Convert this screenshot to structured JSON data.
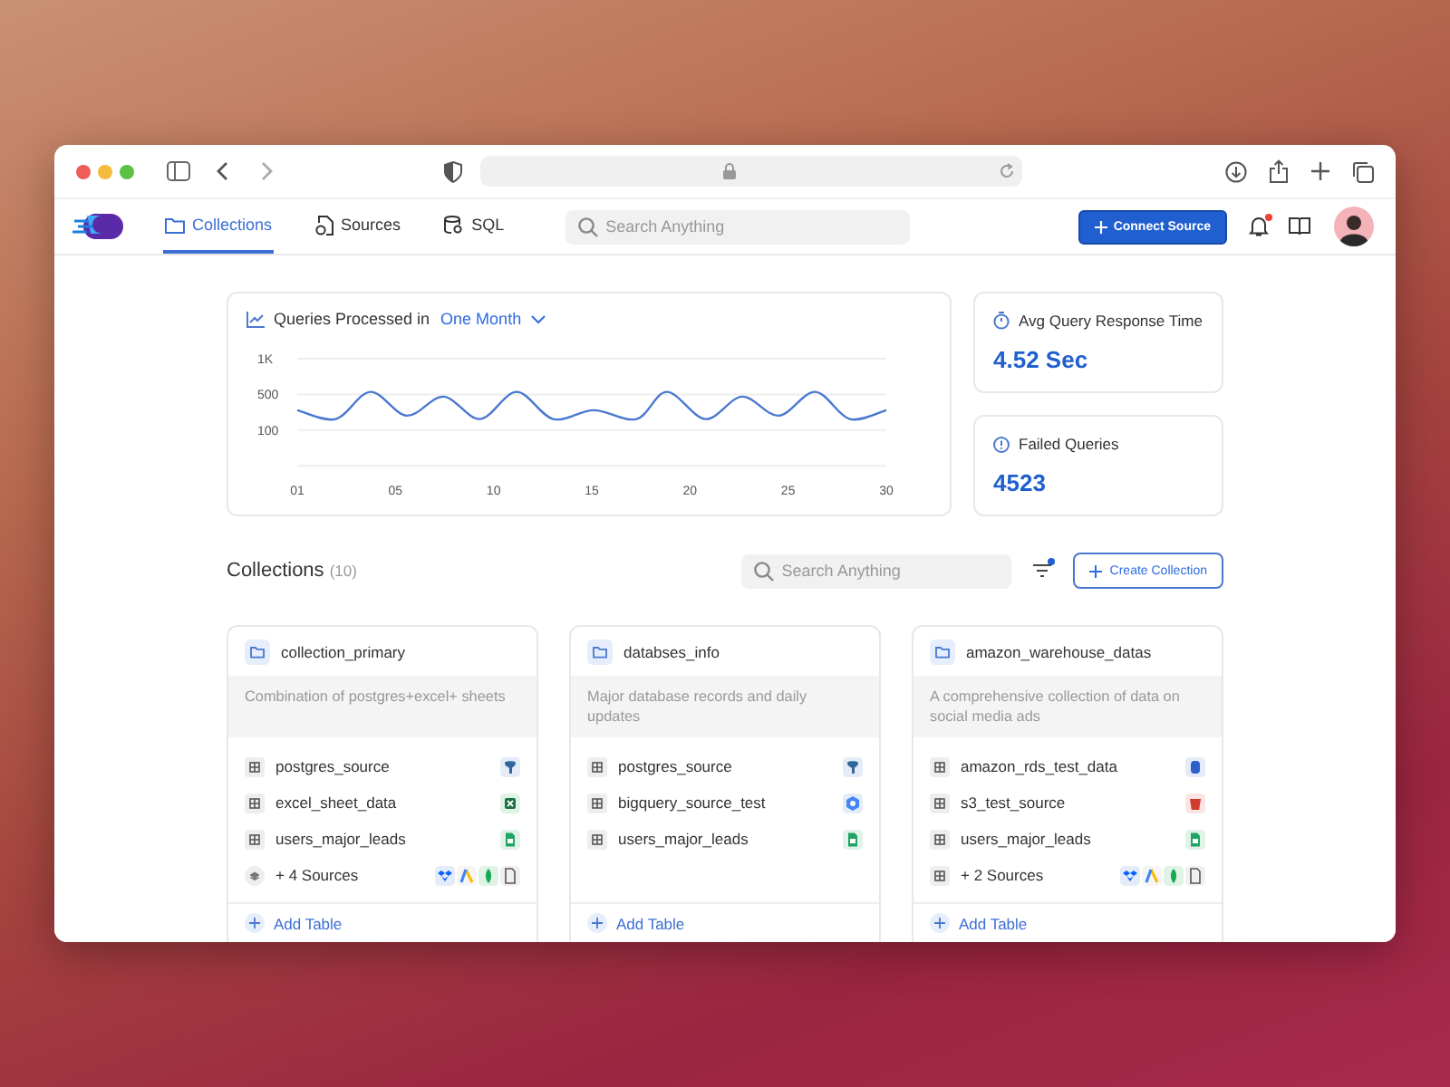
{
  "nav": {
    "tabs": [
      {
        "label": "Collections",
        "kind": "folder",
        "selected": true
      },
      {
        "label": "Sources",
        "kind": "sources",
        "selected": false
      },
      {
        "label": "SQL",
        "kind": "sql",
        "selected": false
      }
    ],
    "search": {
      "placeholder": "Search Anything"
    },
    "connect_button": "Connect Source",
    "notifications": {
      "unread": true
    }
  },
  "queries_card": {
    "title": "Queries Processed in",
    "period": "One Month",
    "y_axis_labels": [
      "1K",
      "500",
      "100"
    ],
    "x_axis_labels": [
      "01",
      "05",
      "10",
      "15",
      "20",
      "25",
      "30"
    ]
  },
  "stats": [
    {
      "label": "Avg Query Response Time",
      "value": "4.52 Sec",
      "kind": "timer"
    },
    {
      "label": "Failed Queries",
      "value": "4523",
      "kind": "alert"
    }
  ],
  "collections": {
    "title": "Collections",
    "count": "(10)",
    "search": {
      "placeholder": "Search Anything"
    },
    "filter": {
      "active": true
    },
    "create_button": "Create Collection",
    "items": [
      {
        "name": "collection_primary",
        "description": "Combination of postgres+excel+ sheets",
        "add_label": "Add Table",
        "sources": [
          {
            "name": "postgres_source",
            "kind": "table",
            "logos": [
              {
                "kind": "postgres"
              }
            ]
          },
          {
            "name": "excel_sheet_data",
            "kind": "table",
            "logos": [
              {
                "kind": "excel"
              }
            ]
          },
          {
            "name": "users_major_leads",
            "kind": "table",
            "logos": [
              {
                "kind": "sheets"
              }
            ]
          },
          {
            "name": "+ 4 Sources",
            "kind": "stack",
            "logos": [
              {
                "kind": "dropbox"
              },
              {
                "kind": "ads"
              },
              {
                "kind": "leaf"
              },
              {
                "kind": "file"
              }
            ]
          }
        ]
      },
      {
        "name": "databses_info",
        "description": "Major database records and daily updates",
        "add_label": "Add Table",
        "sources": [
          {
            "name": "postgres_source",
            "kind": "table",
            "logos": [
              {
                "kind": "postgres"
              }
            ]
          },
          {
            "name": "bigquery_source_test",
            "kind": "table",
            "logos": [
              {
                "kind": "bigquery"
              }
            ]
          },
          {
            "name": "users_major_leads",
            "kind": "table",
            "logos": [
              {
                "kind": "sheets"
              }
            ]
          }
        ]
      },
      {
        "name": "amazon_warehouse_datas",
        "description": "A comprehensive collection of data on social media ads",
        "add_label": "Add Table",
        "sources": [
          {
            "name": "amazon_rds_test_data",
            "kind": "table",
            "logos": [
              {
                "kind": "rds"
              }
            ]
          },
          {
            "name": "s3_test_source",
            "kind": "table",
            "logos": [
              {
                "kind": "s3"
              }
            ]
          },
          {
            "name": "users_major_leads",
            "kind": "table",
            "logos": [
              {
                "kind": "sheets"
              }
            ]
          },
          {
            "name": "+ 2 Sources",
            "kind": "table",
            "logos": [
              {
                "kind": "dropbox"
              },
              {
                "kind": "ads"
              },
              {
                "kind": "leaf"
              },
              {
                "kind": "file"
              }
            ]
          }
        ]
      }
    ]
  }
}
